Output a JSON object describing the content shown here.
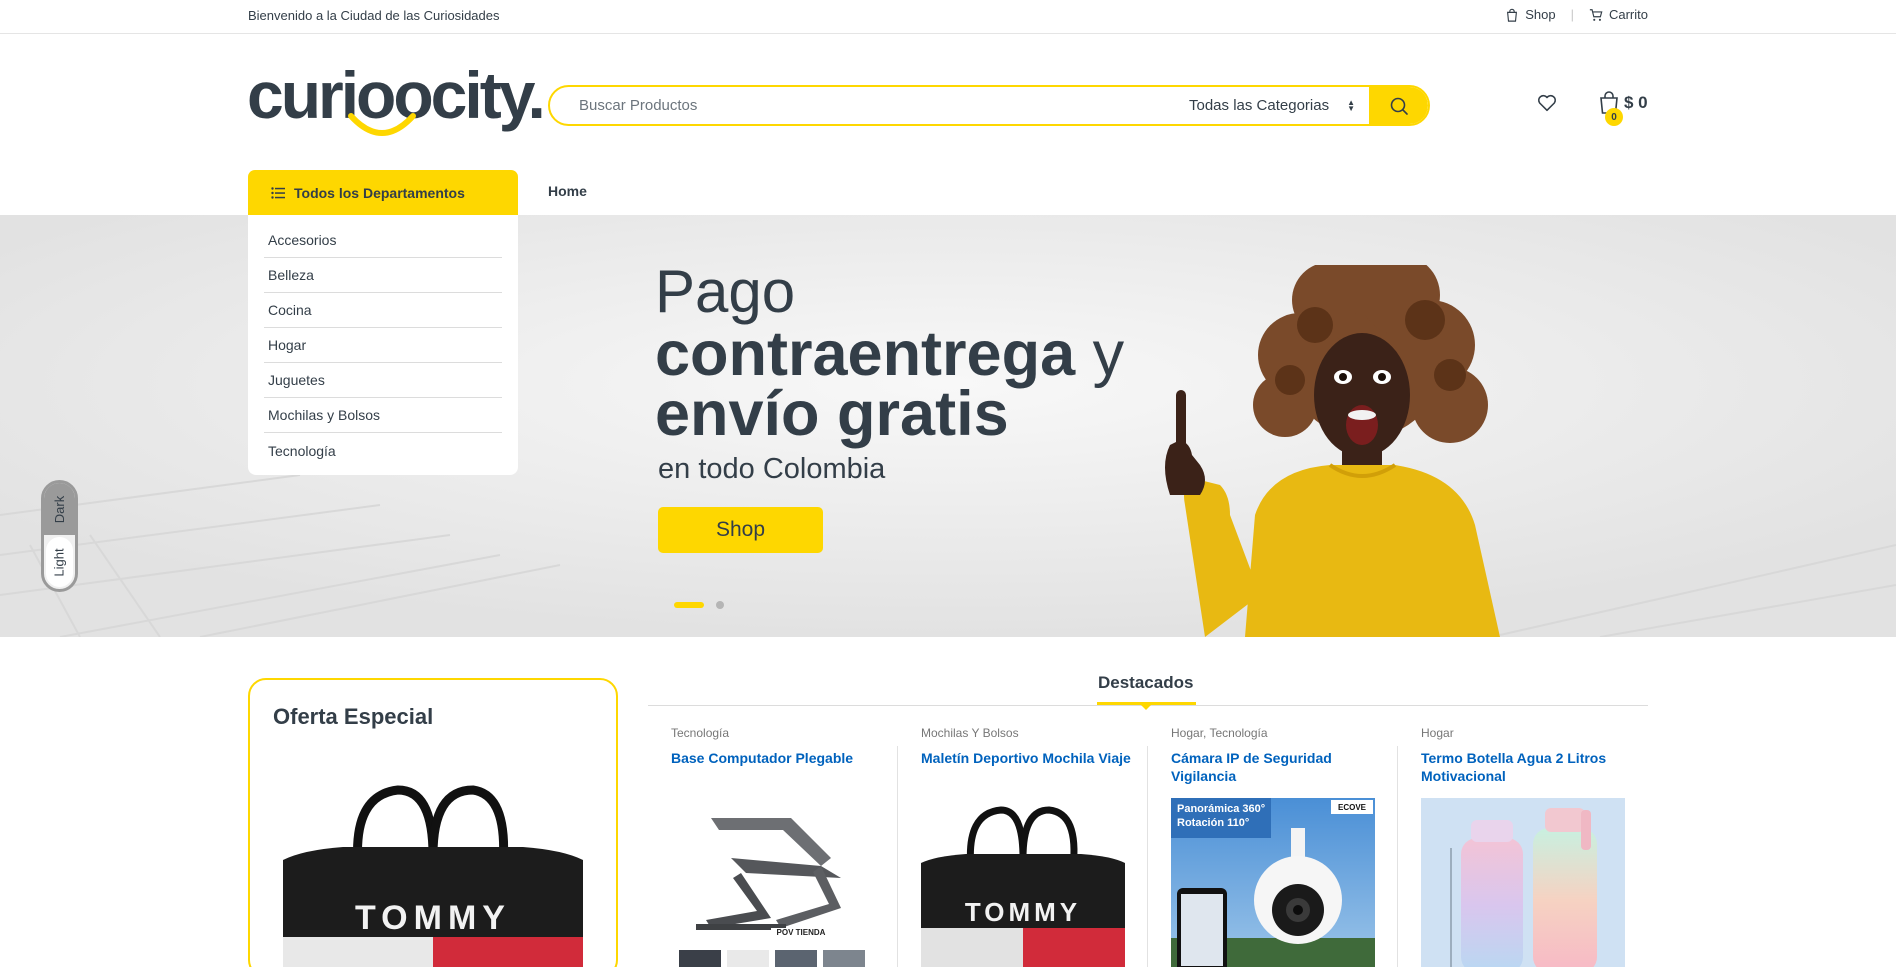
{
  "topbar": {
    "welcome": "Bienvenido a la Ciudad de las Curiosidades",
    "shop_label": "Shop",
    "cart_label": "Carrito",
    "separator": "|"
  },
  "header": {
    "logo_text": "curioocity.",
    "search_placeholder": "Buscar Productos",
    "category_select": "Todas las Categorias",
    "cart_count": "0",
    "cart_total": "$ 0"
  },
  "nav": {
    "departments_label": "Todos los Departamentos",
    "home_label": "Home",
    "departments": [
      "Accesorios",
      "Belleza",
      "Cocina",
      "Hogar",
      "Juguetes",
      "Mochilas y Bolsos",
      "Tecnología"
    ]
  },
  "hero": {
    "line1": "Pago",
    "line2a": "contraentrega",
    "line2b": " y",
    "line3": "envío gratis",
    "line4": "en todo Colombia",
    "button": "Shop",
    "active_slide": 1,
    "slide_count": 2
  },
  "theme_toggle": {
    "dark": "Dark",
    "light": "Light",
    "selected": "Light"
  },
  "oferta": {
    "title": "Oferta Especial"
  },
  "featured": {
    "tab": "Destacados",
    "products": [
      {
        "category": "Tecnología",
        "name": "Base Computador Plegable"
      },
      {
        "category": "Mochilas Y Bolsos",
        "name": "Maletín Deportivo Mochila Viaje"
      },
      {
        "category": "Hogar, Tecnología",
        "name": "Cámara IP de Seguridad Vigilancia"
      },
      {
        "category": "Hogar",
        "name": "Termo Botella Agua 2 Litros Motivacional"
      }
    ],
    "camera_overlay": [
      "Panorámica 360°",
      "Rotación 110°"
    ],
    "camera_brand": "ECOVE",
    "stand_brand": "POV TIENDA",
    "bag_brand": "TOMMY"
  },
  "colors": {
    "accent": "#fed700",
    "text": "#333e48",
    "link": "#0062bd"
  }
}
